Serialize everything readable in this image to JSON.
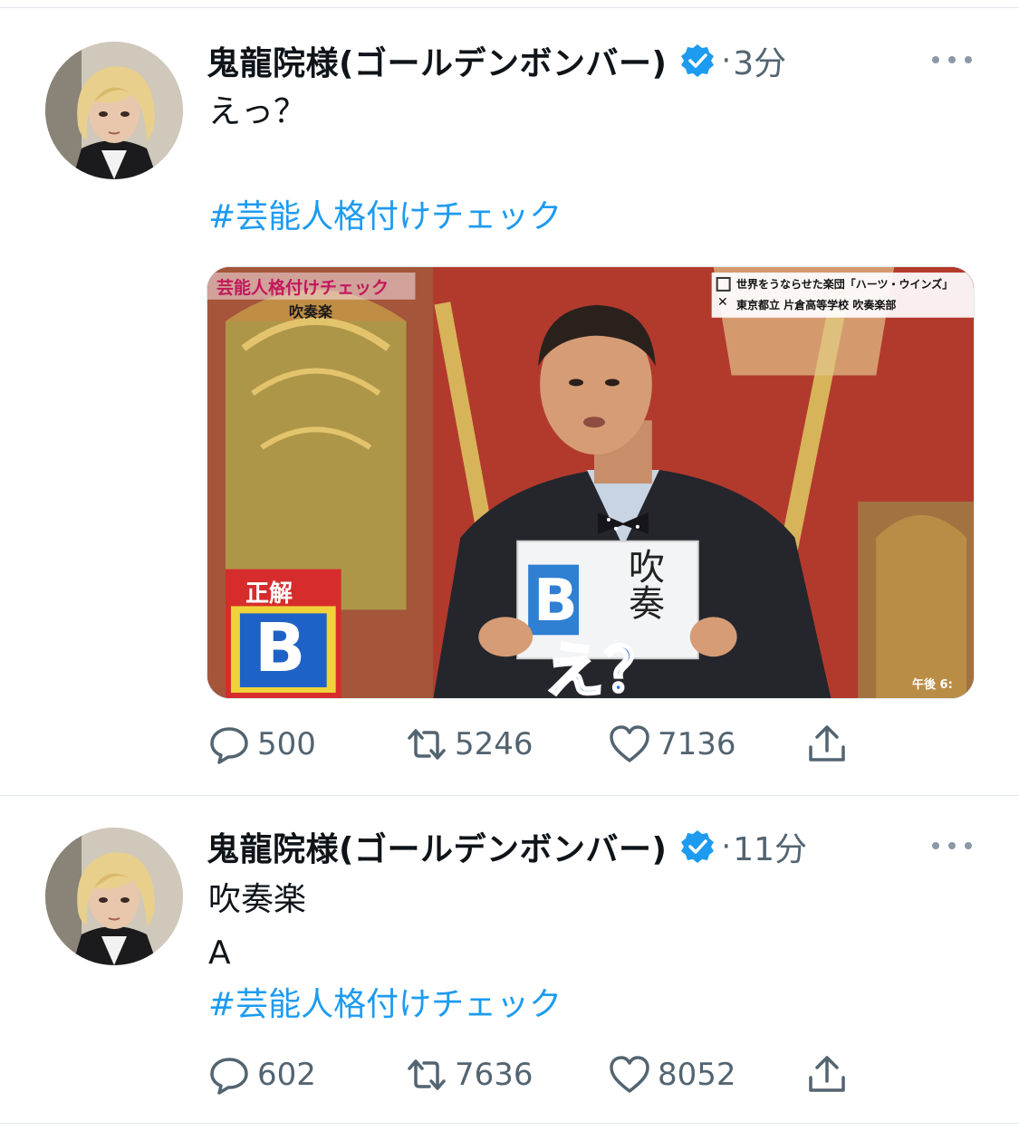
{
  "tweets": [
    {
      "author": "鬼龍院様(ゴールデンボンバー)",
      "dot": "·",
      "time": "3分",
      "text_line1": "えっ？",
      "hashtag": "#芸能人格付けチェック",
      "media": {
        "show_title": "芸能人格付けチェック",
        "category": "吹奏楽",
        "option_a": "世界をうならせた楽団「ハーツ・ウインズ」",
        "option_b": "東京都立 片倉高等学校 吹奏楽部",
        "correct_label": "正解",
        "correct_letter": "B",
        "card_text": "吹奏",
        "card_letter": "B",
        "caption": "え？",
        "clock": "午後 6:"
      },
      "replies": "500",
      "retweets": "5246",
      "likes": "7136"
    },
    {
      "author": "鬼龍院様(ゴールデンボンバー)",
      "dot": "·",
      "time": "11分",
      "text_line1": "吹奏楽",
      "text_line2": "A",
      "hashtag": "#芸能人格付けチェック",
      "replies": "602",
      "retweets": "7636",
      "likes": "8052"
    }
  ],
  "icons": {
    "verified": "verified-badge-icon",
    "more": "more-dots-icon",
    "reply": "reply-bubble-icon",
    "retweet": "retweet-arrows-icon",
    "like": "heart-icon",
    "share": "share-upload-icon"
  },
  "colors": {
    "link": "#1d9bf0",
    "secondary": "#536471",
    "verified": "#1d9bf0"
  }
}
